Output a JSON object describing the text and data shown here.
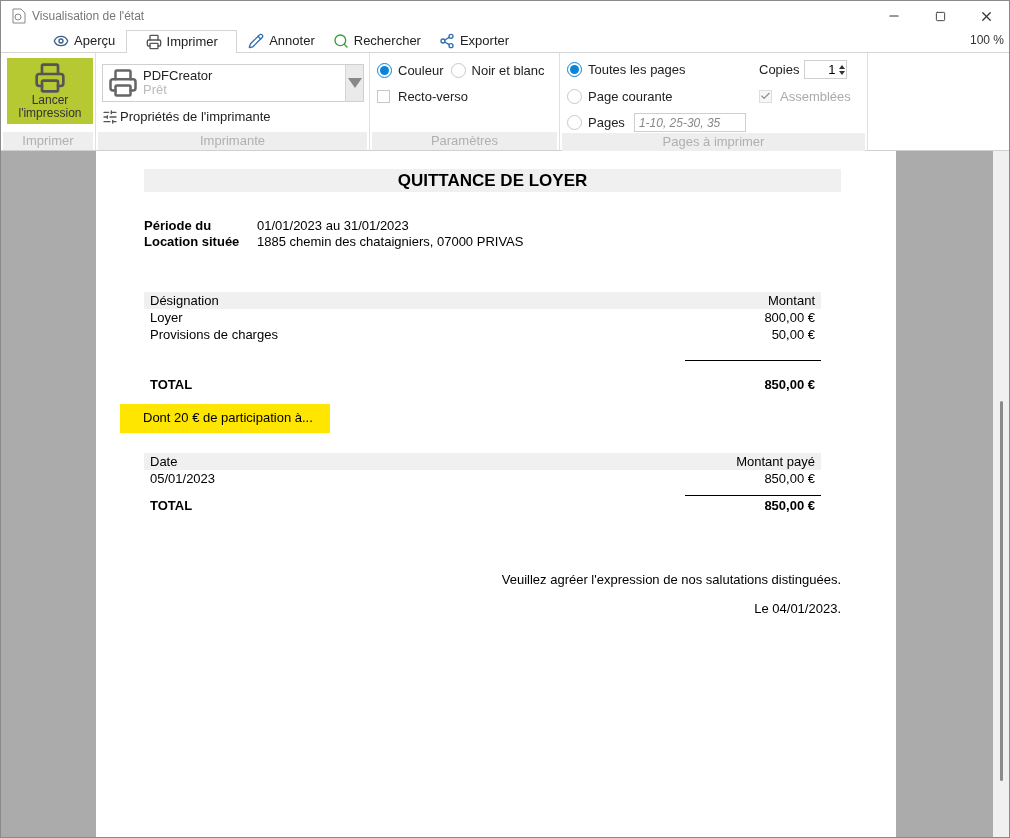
{
  "window": {
    "title": "Visualisation de l'état"
  },
  "tabs": [
    {
      "label": "Aperçu",
      "kind": "preview",
      "selected": false
    },
    {
      "label": "Imprimer",
      "kind": "print",
      "selected": true
    },
    {
      "label": "Annoter",
      "kind": "annotate",
      "selected": false
    },
    {
      "label": "Rechercher",
      "kind": "search",
      "selected": false
    },
    {
      "label": "Exporter",
      "kind": "export",
      "selected": false
    }
  ],
  "zoom": "100 %",
  "ribbon": {
    "print_group": {
      "button": "Lancer l'impression",
      "label": "Imprimer"
    },
    "printer_group": {
      "printer": {
        "name": "PDFCreator",
        "status": "Prêt"
      },
      "properties": "Propriétés de l'imprimante",
      "label": "Imprimante"
    },
    "settings_group": {
      "color_modes": [
        {
          "label": "Couleur",
          "selected": true
        },
        {
          "label": "Noir et blanc",
          "selected": false
        }
      ],
      "duplex": {
        "label": "Recto-verso",
        "checked": false
      },
      "label": "Paramètres"
    },
    "pages_group": {
      "ranges": [
        {
          "label": "Toutes les pages",
          "selected": true
        },
        {
          "label": "Page courante",
          "selected": false
        },
        {
          "label": "Pages",
          "selected": false
        }
      ],
      "pages_field": {
        "placeholder": "1-10, 25-30, 35"
      },
      "copies": {
        "label": "Copies",
        "value": "1"
      },
      "collate": {
        "label": "Assemblées",
        "checked": true,
        "disabled": true
      },
      "label": "Pages à imprimer"
    }
  },
  "document": {
    "title": "QUITTANCE DE LOYER",
    "info": [
      {
        "label": "Période du",
        "value": "01/01/2023 au 31/01/2023"
      },
      {
        "label": "Location située",
        "value": "1885 chemin des chataigniers, 07000 PRIVAS"
      }
    ],
    "charges": {
      "columns": [
        "Désignation",
        "Montant"
      ],
      "rows": [
        [
          "Loyer",
          "800,00 €"
        ],
        [
          "Provisions de charges",
          "50,00 €"
        ]
      ],
      "total": [
        "TOTAL",
        "850,00 €"
      ]
    },
    "note": "Dont 20 € de participation à...",
    "payments": {
      "columns": [
        "Date",
        "Montant payé"
      ],
      "rows": [
        [
          "05/01/2023",
          "850,00 €"
        ]
      ],
      "total": [
        "TOTAL",
        "850,00 €"
      ]
    },
    "closing": "Veuillez agréer l'expression de nos salutations distinguées.",
    "date": "Le 04/01/2023."
  }
}
